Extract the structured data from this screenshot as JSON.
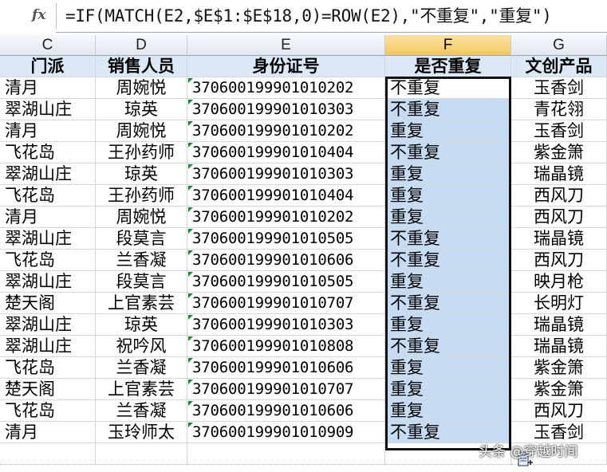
{
  "formula_bar": {
    "fx_label": "fx",
    "formula": "=IF(MATCH(E2,$E$1:$E$18,0)=ROW(E2),\"不重复\",\"重复\")"
  },
  "columns": [
    "C",
    "D",
    "E",
    "F",
    "G"
  ],
  "headers": [
    "门派",
    "销售人员",
    "身份证号",
    "是否重复",
    "文创产品"
  ],
  "rows": [
    [
      "清月",
      "周婉悦",
      "370600199901010202",
      "不重复",
      "玉香剑"
    ],
    [
      "翠湖山庄",
      "琼英",
      "370600199901010303",
      "不重复",
      "青花翎"
    ],
    [
      "清月",
      "周婉悦",
      "370600199901010202",
      "重复",
      "玉香剑"
    ],
    [
      "飞花岛",
      "王孙药师",
      "370600199901010404",
      "不重复",
      "紫金箫"
    ],
    [
      "翠湖山庄",
      "琼英",
      "370600199901010303",
      "重复",
      "瑞晶镜"
    ],
    [
      "飞花岛",
      "王孙药师",
      "370600199901010404",
      "重复",
      "西风刀"
    ],
    [
      "清月",
      "周婉悦",
      "370600199901010202",
      "重复",
      "西风刀"
    ],
    [
      "翠湖山庄",
      "段莫言",
      "370600199901010505",
      "不重复",
      "瑞晶镜"
    ],
    [
      "飞花岛",
      "兰香凝",
      "370600199901010606",
      "不重复",
      "西风刀"
    ],
    [
      "翠湖山庄",
      "段莫言",
      "370600199901010505",
      "重复",
      "映月枪"
    ],
    [
      "楚天阁",
      "上官素芸",
      "370600199901010707",
      "不重复",
      "长明灯"
    ],
    [
      "翠湖山庄",
      "琼英",
      "370600199901010303",
      "重复",
      "瑞晶镜"
    ],
    [
      "翠湖山庄",
      "祝吟风",
      "370600199901010808",
      "不重复",
      "瑞晶镜"
    ],
    [
      "飞花岛",
      "兰香凝",
      "370600199901010606",
      "重复",
      "紫金箫"
    ],
    [
      "楚天阁",
      "上官素芸",
      "370600199901010707",
      "重复",
      "紫金箫"
    ],
    [
      "飞花岛",
      "兰香凝",
      "370600199901010606",
      "重复",
      "西风刀"
    ],
    [
      "清月",
      "玉玲师太",
      "370600199901010909",
      "不重复",
      "玉香剑"
    ]
  ],
  "watermark": "头条 @穿越时间"
}
